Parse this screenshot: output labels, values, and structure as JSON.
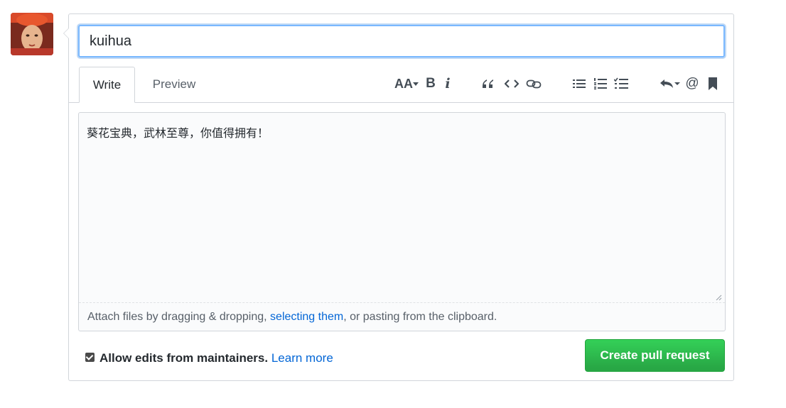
{
  "title_input": {
    "value": "kuihua"
  },
  "tabs": {
    "write": "Write",
    "preview": "Preview"
  },
  "toolbar": {
    "header": "AA",
    "bold": "B",
    "italic": "i",
    "mention": "@"
  },
  "editor": {
    "body": "葵花宝典，武林至尊，你值得拥有！"
  },
  "attach": {
    "prefix": "Attach files by dragging & dropping, ",
    "link": "selecting them",
    "suffix": ", or pasting from the clipboard."
  },
  "footer": {
    "checkbox_label": "Allow edits from maintainers.",
    "learn_more": "Learn more",
    "create_button": "Create pull request"
  },
  "colors": {
    "accent_blue": "#0366d6",
    "button_green": "#2cbe4e",
    "focus_border": "#79b8ff"
  }
}
